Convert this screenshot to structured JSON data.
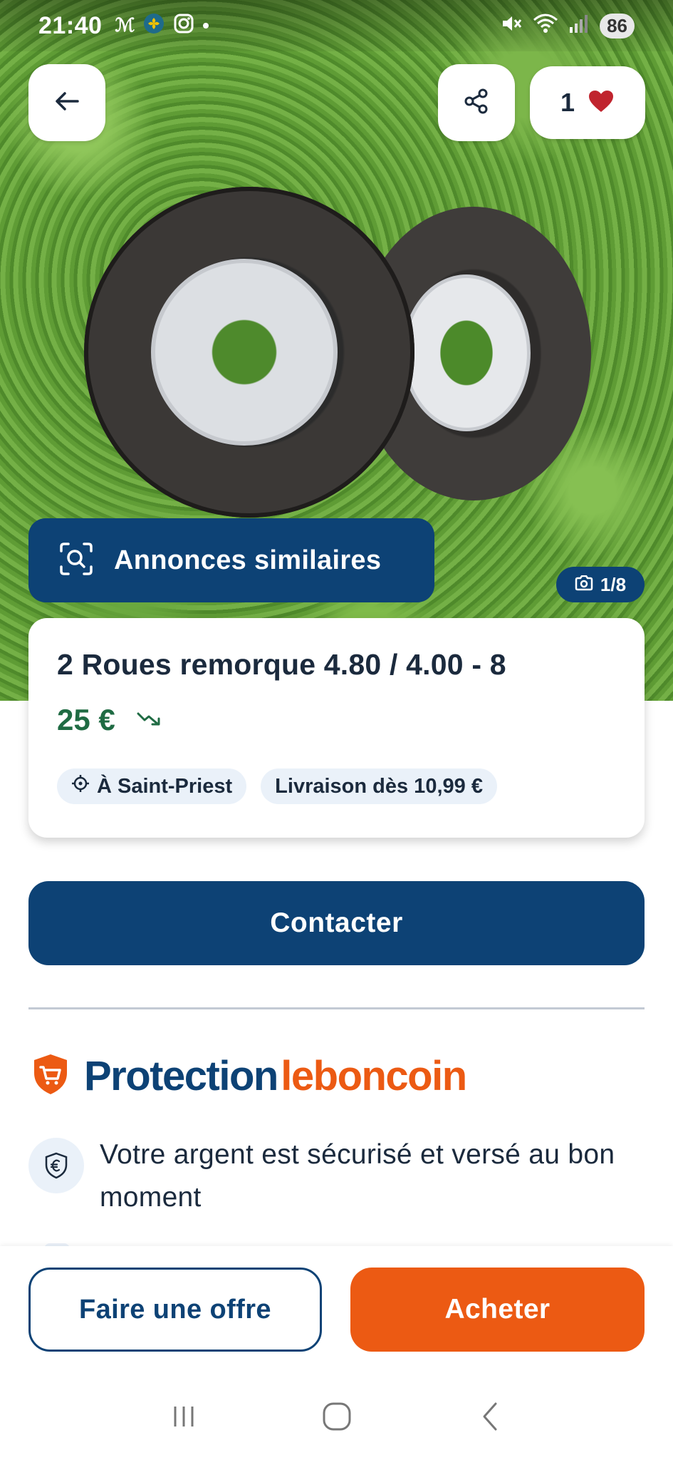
{
  "status_bar": {
    "time": "21:40",
    "left_icons": [
      "newspaper-icon",
      "clover-app-icon",
      "instagram-icon",
      "dot-icon"
    ],
    "right_icons": [
      "mute-icon",
      "wifi-icon",
      "signal-icon"
    ],
    "battery": "86"
  },
  "header": {
    "back_icon": "arrow-left-icon",
    "share_icon": "share-icon",
    "favorite_count": "1",
    "favorite_icon": "heart-icon"
  },
  "gallery": {
    "similar_label": "Annonces similaires",
    "photo_counter": "1/8"
  },
  "listing": {
    "title": "2 Roues remorque 4.80 / 4.00 - 8",
    "price": "25 €",
    "price_trend_icon": "trend-down-icon",
    "location_chip": "À Saint-Priest",
    "delivery_chip": "Livraison dès 10,99 €"
  },
  "actions": {
    "contact_label": "Contacter"
  },
  "protection": {
    "title_part1": "Protection",
    "title_part2": "leboncoin",
    "feature_text": "Votre argent est sécurisé et versé au bon moment"
  },
  "bottom_bar": {
    "offer_label": "Faire une offre",
    "buy_label": "Acheter"
  },
  "colors": {
    "brand_blue": "#0d4275",
    "brand_orange": "#ec5a13",
    "price_green": "#1f6b43",
    "chip_bg": "#eaf1f9"
  }
}
